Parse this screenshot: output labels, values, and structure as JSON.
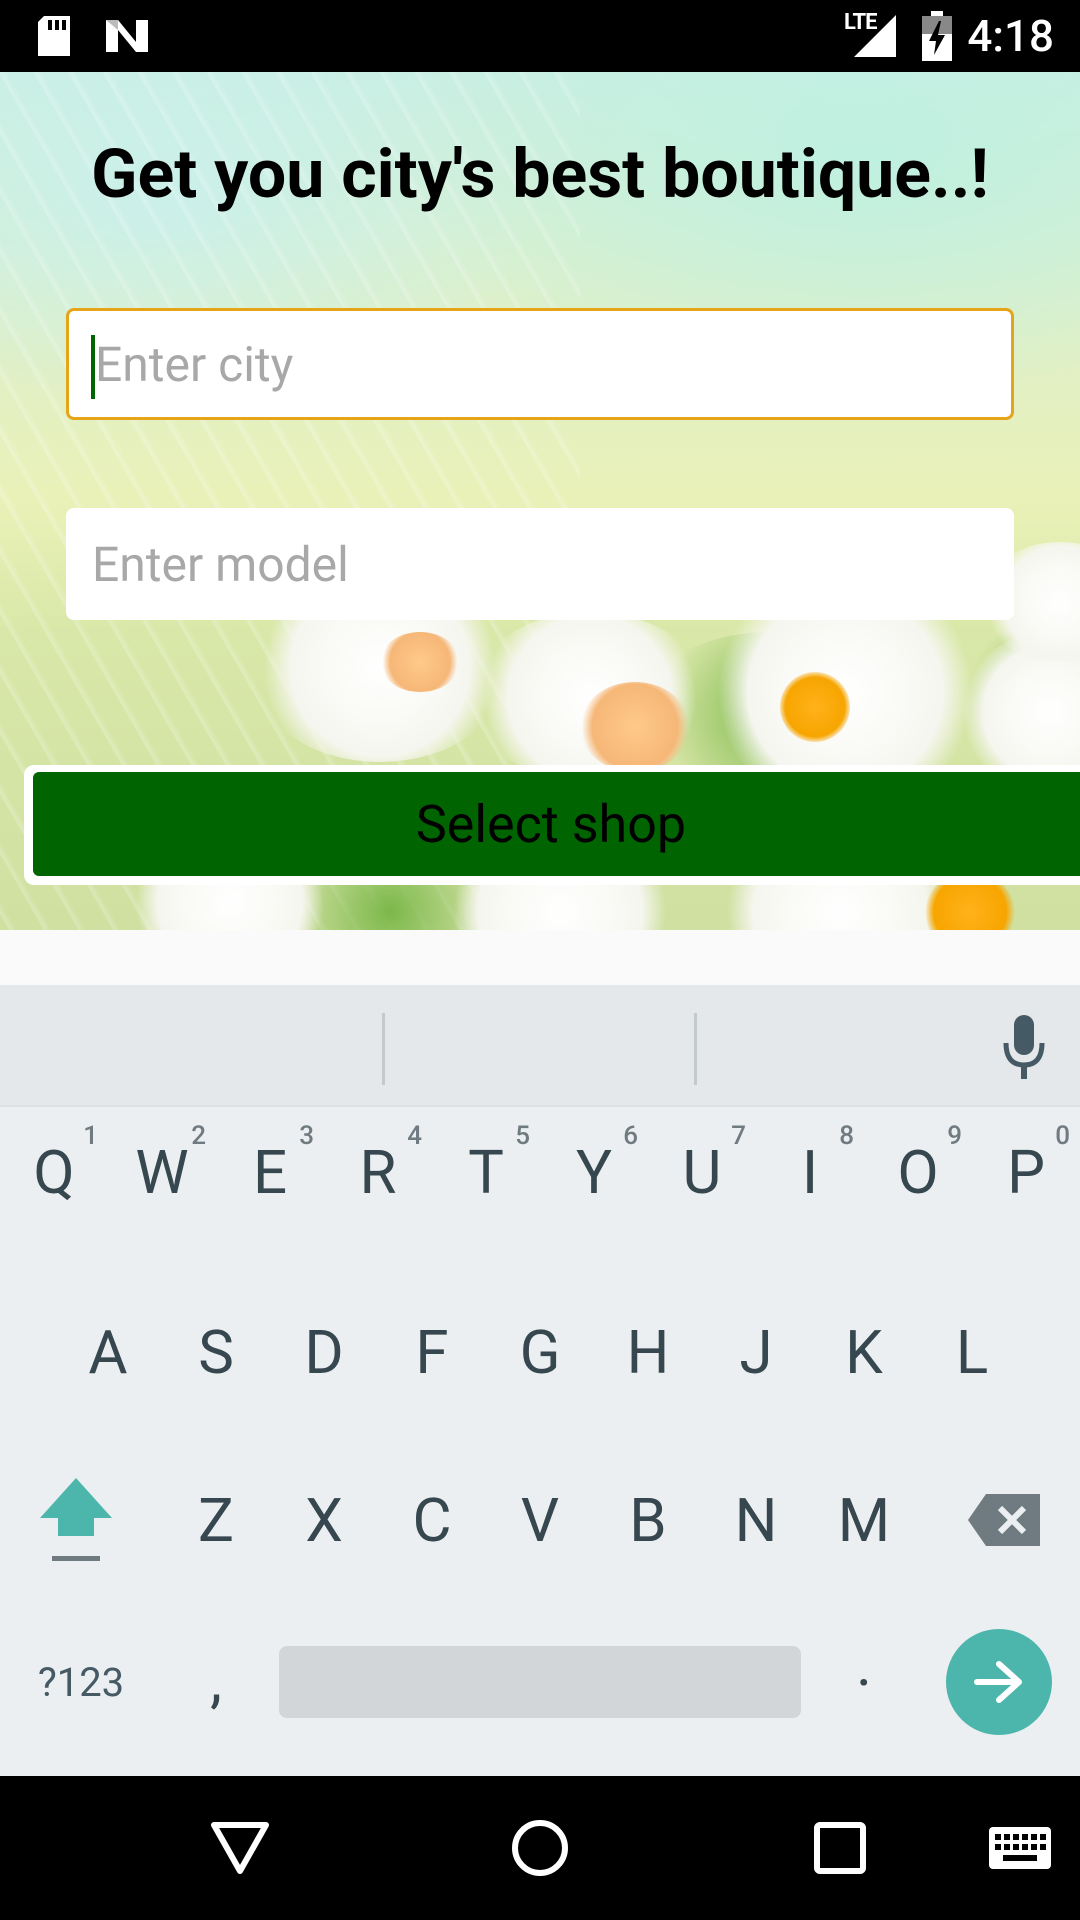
{
  "status_bar": {
    "time": "4:18",
    "network": "LTE",
    "icons": [
      "sd-card-icon",
      "n-logo-icon",
      "lte-signal-icon",
      "battery-charging-icon"
    ]
  },
  "main": {
    "title": "Get you city's best boutique..!",
    "city_input": {
      "value": "",
      "placeholder": "Enter city"
    },
    "model_input": {
      "value": "",
      "placeholder": "Enter model"
    },
    "select_shop_label": "Select shop",
    "colors": {
      "button": "#006400",
      "focus_border": "#e6a419"
    }
  },
  "keyboard": {
    "row1": [
      {
        "k": "Q",
        "h": "1"
      },
      {
        "k": "W",
        "h": "2"
      },
      {
        "k": "E",
        "h": "3"
      },
      {
        "k": "R",
        "h": "4"
      },
      {
        "k": "T",
        "h": "5"
      },
      {
        "k": "Y",
        "h": "6"
      },
      {
        "k": "U",
        "h": "7"
      },
      {
        "k": "I",
        "h": "8"
      },
      {
        "k": "O",
        "h": "9"
      },
      {
        "k": "P",
        "h": "0"
      }
    ],
    "row2": [
      "A",
      "S",
      "D",
      "F",
      "G",
      "H",
      "J",
      "K",
      "L"
    ],
    "row3": [
      "Z",
      "X",
      "C",
      "V",
      "B",
      "N",
      "M"
    ],
    "symbols_label": "?123",
    "comma": ",",
    "period": ".",
    "accent": "#4db6ac"
  },
  "nav_bar": {
    "buttons": [
      "back-icon",
      "home-icon",
      "recents-icon",
      "keyboard-switch-icon"
    ]
  }
}
